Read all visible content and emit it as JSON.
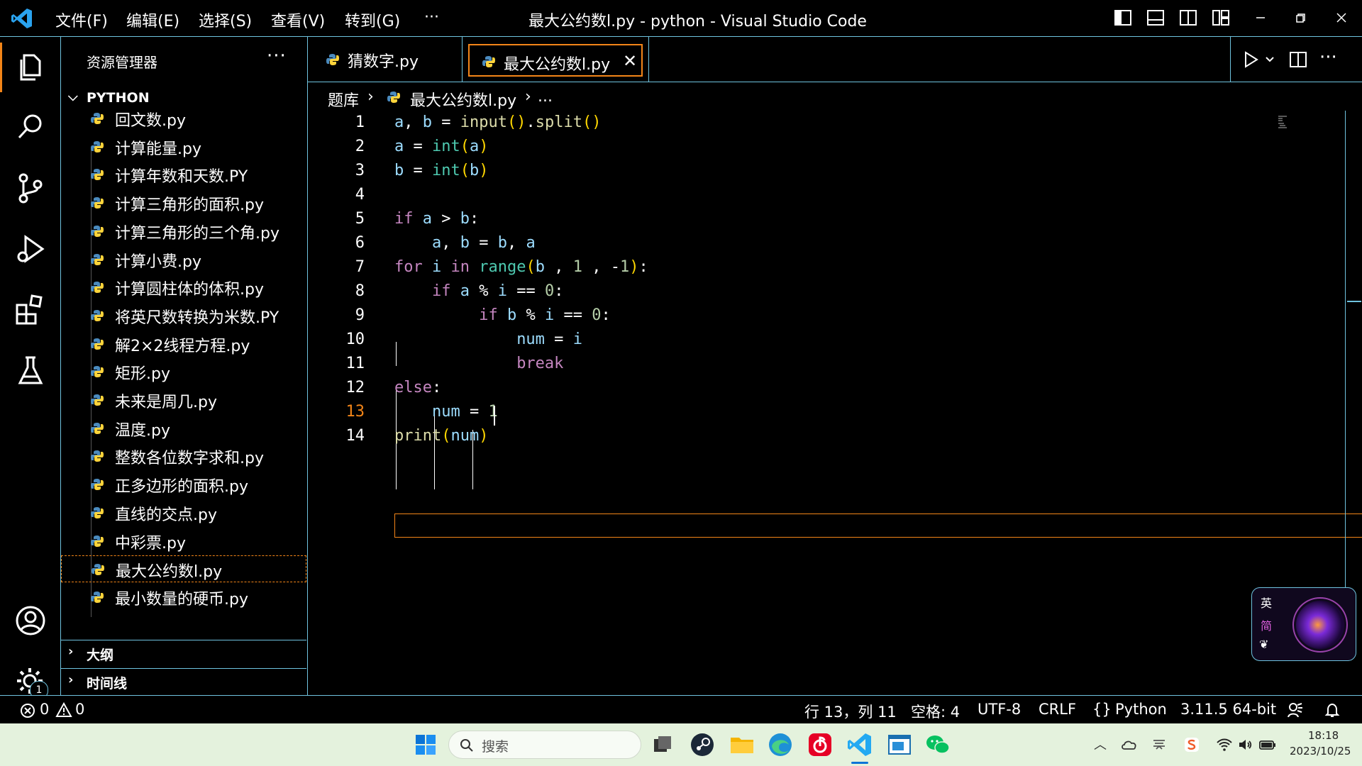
{
  "window": {
    "title": "最大公约数l.py - python - Visual Studio Code",
    "menus": [
      "文件(F)",
      "编辑(E)",
      "选择(S)",
      "查看(V)",
      "转到(G)",
      "···"
    ]
  },
  "sidebar": {
    "title": "资源管理器",
    "more": "···",
    "folder": "PYTHON",
    "files": [
      "回文数.py",
      "计算能量.py",
      "计算年数和天数.PY",
      "计算三角形的面积.py",
      "计算三角形的三个角.py",
      "计算小费.py",
      "计算圆柱体的体积.py",
      "将英尺数转换为米数.PY",
      "解2×2线程方程.py",
      "矩形.py",
      "未来是周几.py",
      "温度.py",
      "整数各位数字求和.py",
      "正多边形的面积.py",
      "直线的交点.py",
      "中彩票.py",
      "最大公约数l.py",
      "最小数量的硬币.py"
    ],
    "outline": "大纲",
    "timeline": "时间线",
    "settings_badge": "1"
  },
  "tabs": [
    {
      "label": "猜数字.py",
      "active": false
    },
    {
      "label": "最大公约数l.py",
      "active": true
    }
  ],
  "breadcrumb": {
    "folder": "题库",
    "file": "最大公约数l.py",
    "more": "..."
  },
  "editor": {
    "line_numbers": [
      "1",
      "2",
      "3",
      "4",
      "5",
      "6",
      "7",
      "8",
      "9",
      "10",
      "11",
      "12",
      "13",
      "14"
    ],
    "current_line": 13
  },
  "status": {
    "errors": "0",
    "warnings": "0",
    "position": "行 13，列 11",
    "spaces": "空格: 4",
    "encoding": "UTF-8",
    "eol": "CRLF",
    "language": "Python",
    "interpreter": "3.11.5 64-bit"
  },
  "taskbar": {
    "search_placeholder": "搜索",
    "time": "18:18",
    "date": "2023/10/25",
    "ime_lang": "英",
    "ime_mode": "简"
  },
  "colors": {
    "accent": "#6fc3df",
    "active_border": "#f38518",
    "taskbar_bg": "#e4f2dd"
  }
}
